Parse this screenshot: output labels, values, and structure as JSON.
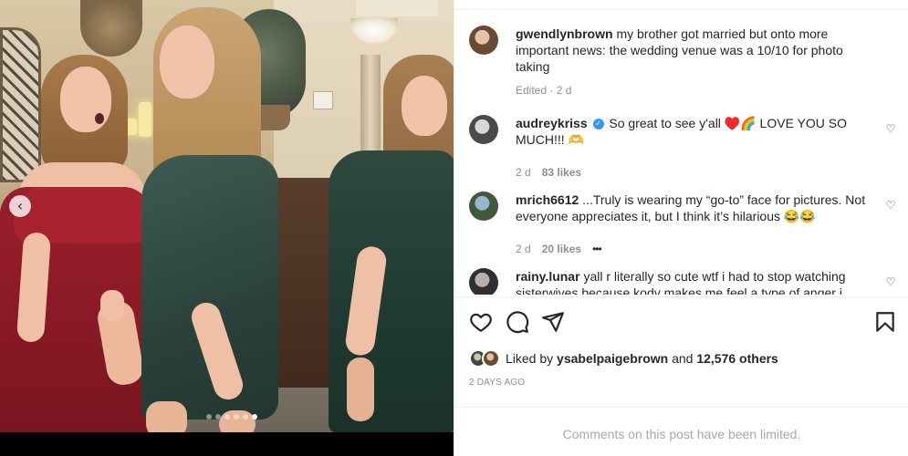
{
  "carousel": {
    "prev_arrow": "‹",
    "dot_count": 6,
    "active_dot": 5
  },
  "post": {
    "caption": {
      "username": "gwendlynbrown",
      "text": "my brother got married but onto more important news: the wedding venue was a 10/10 for photo taking",
      "edited": "Edited",
      "age": "2 d"
    },
    "comments": [
      {
        "username": "audreykriss",
        "verified": true,
        "text": "So great to see y'all ♥️🌈 LOVE YOU SO MUCH!!! 🫶",
        "age": "2 d",
        "likes": "83 likes"
      },
      {
        "username": "mrich6612",
        "text": "...Truly is wearing my “go-to” face for pictures. Not everyone appreciates it, but I think it’s hilarious 😂😂",
        "age": "2 d",
        "likes": "20 likes",
        "more": "•••"
      },
      {
        "username": "rainy.lunar",
        "text": "yall r literally so cute wtf i had to stop watching sisterwives because kody makes me feel a type of anger i didn't"
      }
    ],
    "liked_by": {
      "prefix": "Liked by",
      "user": "ysabelpaigebrown",
      "and": "and",
      "others": "12,576 others"
    },
    "timestamp": "2 DAYS AGO",
    "comments_limited": "Comments on this post have been limited."
  },
  "icons": {
    "like": "heart-outline-icon",
    "comment": "speech-bubble-icon",
    "share": "paper-plane-icon",
    "save": "bookmark-icon",
    "comment_like": "small-heart-icon"
  },
  "colors": {
    "text": "#262626",
    "secondary": "#8e8e8e",
    "divider": "#efefef",
    "verified": "#3897f0",
    "muted": "#a8a8a8"
  }
}
